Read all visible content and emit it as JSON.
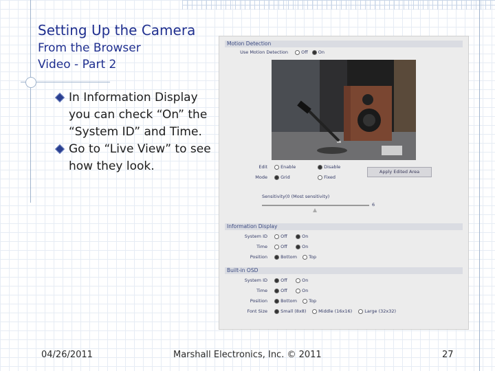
{
  "slide": {
    "title_line1": "Setting Up the Camera",
    "title_line2": "From the Browser",
    "title_line3": "Video - Part 2",
    "bullets": [
      "In Information Display you can check “On” the “System ID” and Time.",
      "Go to “Live View” to see how they look."
    ],
    "footer_date": "04/26/2011",
    "footer_company": "Marshall Electronics, Inc. © 2011",
    "footer_page": "27"
  },
  "screenshot": {
    "motion_detection": {
      "header": "Motion Detection",
      "use_label": "Use Motion Detection",
      "off": "Off",
      "on": "On",
      "use_selected": "On",
      "edit_label": "Edit",
      "enable": "Enable",
      "disable": "Disable",
      "edit_selected": "Disable",
      "mode_label": "Mode",
      "grid": "Grid",
      "fixed": "Fixed",
      "mode_selected": "Grid",
      "apply_button": "Apply Edited Area",
      "sensitivity_label": "Sensitivity(0 (Most sensitivity)",
      "sensitivity_value": "6"
    },
    "information_display": {
      "header": "Information Display",
      "system_id_label": "System ID",
      "time_label": "Time",
      "position_label": "Position",
      "off": "Off",
      "on": "On",
      "bottom": "Bottom",
      "top": "Top",
      "system_id_selected": "On",
      "time_selected": "On",
      "position_selected": "Bottom"
    },
    "built_in_osd": {
      "header": "Built-in OSD",
      "system_id_label": "System ID",
      "time_label": "Time",
      "position_label": "Position",
      "font_size_label": "Font Size",
      "off": "Off",
      "on": "On",
      "bottom": "Bottom",
      "top": "Top",
      "small": "Small (8x8)",
      "middle": "Middle (16x16)",
      "large": "Large (32x32)",
      "system_id_selected": "Off",
      "time_selected": "Off",
      "position_selected": "Bottom",
      "font_size_selected": "Small (8x8)"
    }
  },
  "colors": {
    "title": "#1f2f8f",
    "bullet": "#2a3f8f",
    "grid": "#e6ecf4"
  }
}
